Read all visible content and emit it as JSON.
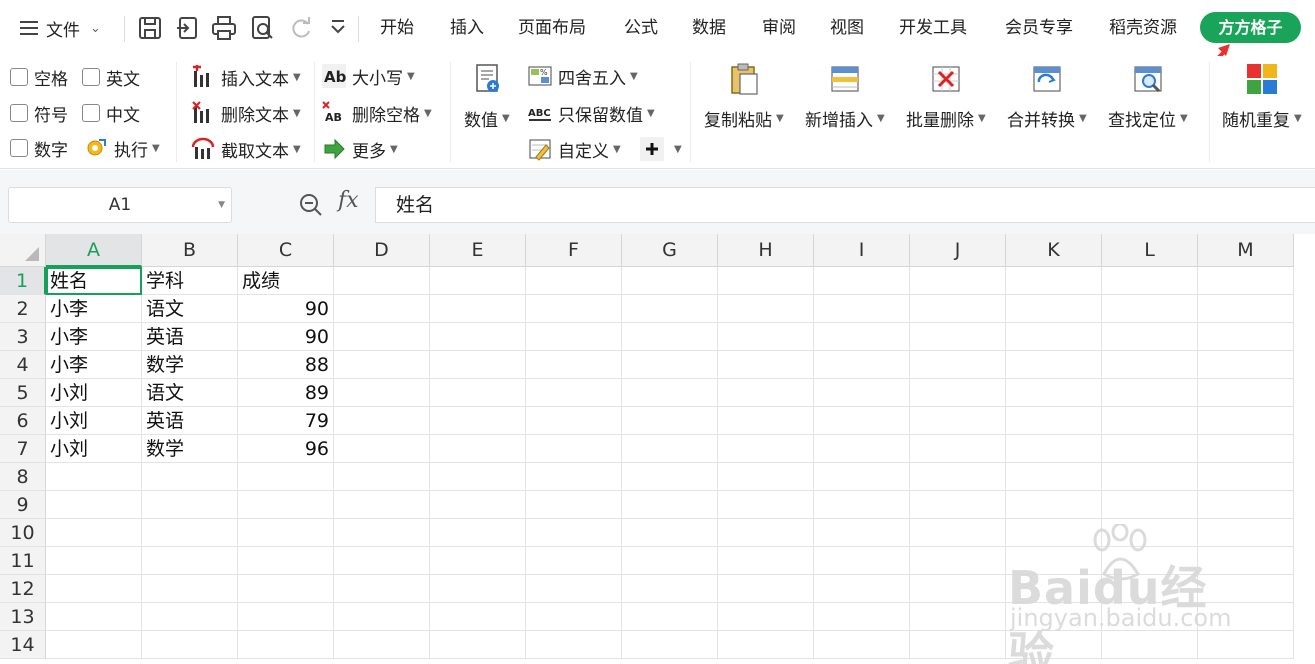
{
  "menubar": {
    "file_label": "文件",
    "tabs": [
      "开始",
      "插入",
      "页面布局",
      "公式",
      "数据",
      "审阅",
      "视图",
      "开发工具",
      "会员专享",
      "稻壳资源"
    ],
    "active_tab": "方方格子",
    "accent_color": "#19a45a"
  },
  "ribbon": {
    "checkboxes": [
      "空格",
      "英文",
      "符号",
      "中文",
      "数字"
    ],
    "execute_label": "执行",
    "text_tools": [
      "插入文本",
      "删除文本",
      "截取文本"
    ],
    "case_tools": [
      "大小写",
      "删除空格",
      "更多"
    ],
    "number_label": "数值",
    "round_tools": [
      "四舍五入",
      "只保留数值",
      "自定义"
    ],
    "big_tools": [
      "复制粘贴",
      "新增插入",
      "批量删除",
      "合并转换",
      "查找定位"
    ],
    "random_label": "随机重复"
  },
  "formula_bar": {
    "cell_ref": "A1",
    "fx_label": "fx",
    "content": "姓名"
  },
  "sheet": {
    "columns": [
      "A",
      "B",
      "C",
      "D",
      "E",
      "F",
      "G",
      "H",
      "I",
      "J",
      "K",
      "L",
      "M"
    ],
    "rows": [
      "1",
      "2",
      "3",
      "4",
      "5",
      "6",
      "7",
      "8",
      "9",
      "10",
      "11",
      "12",
      "13",
      "14"
    ],
    "data": [
      [
        "姓名",
        "学科",
        "成绩"
      ],
      [
        "小李",
        "语文",
        "90"
      ],
      [
        "小李",
        "英语",
        "90"
      ],
      [
        "小李",
        "数学",
        "88"
      ],
      [
        "小刘",
        "语文",
        "89"
      ],
      [
        "小刘",
        "英语",
        "79"
      ],
      [
        "小刘",
        "数学",
        "96"
      ]
    ],
    "selected_color": "#17a05a"
  },
  "watermark": {
    "line1": "Baidu经验",
    "line2": "jingyan.baidu.com"
  }
}
